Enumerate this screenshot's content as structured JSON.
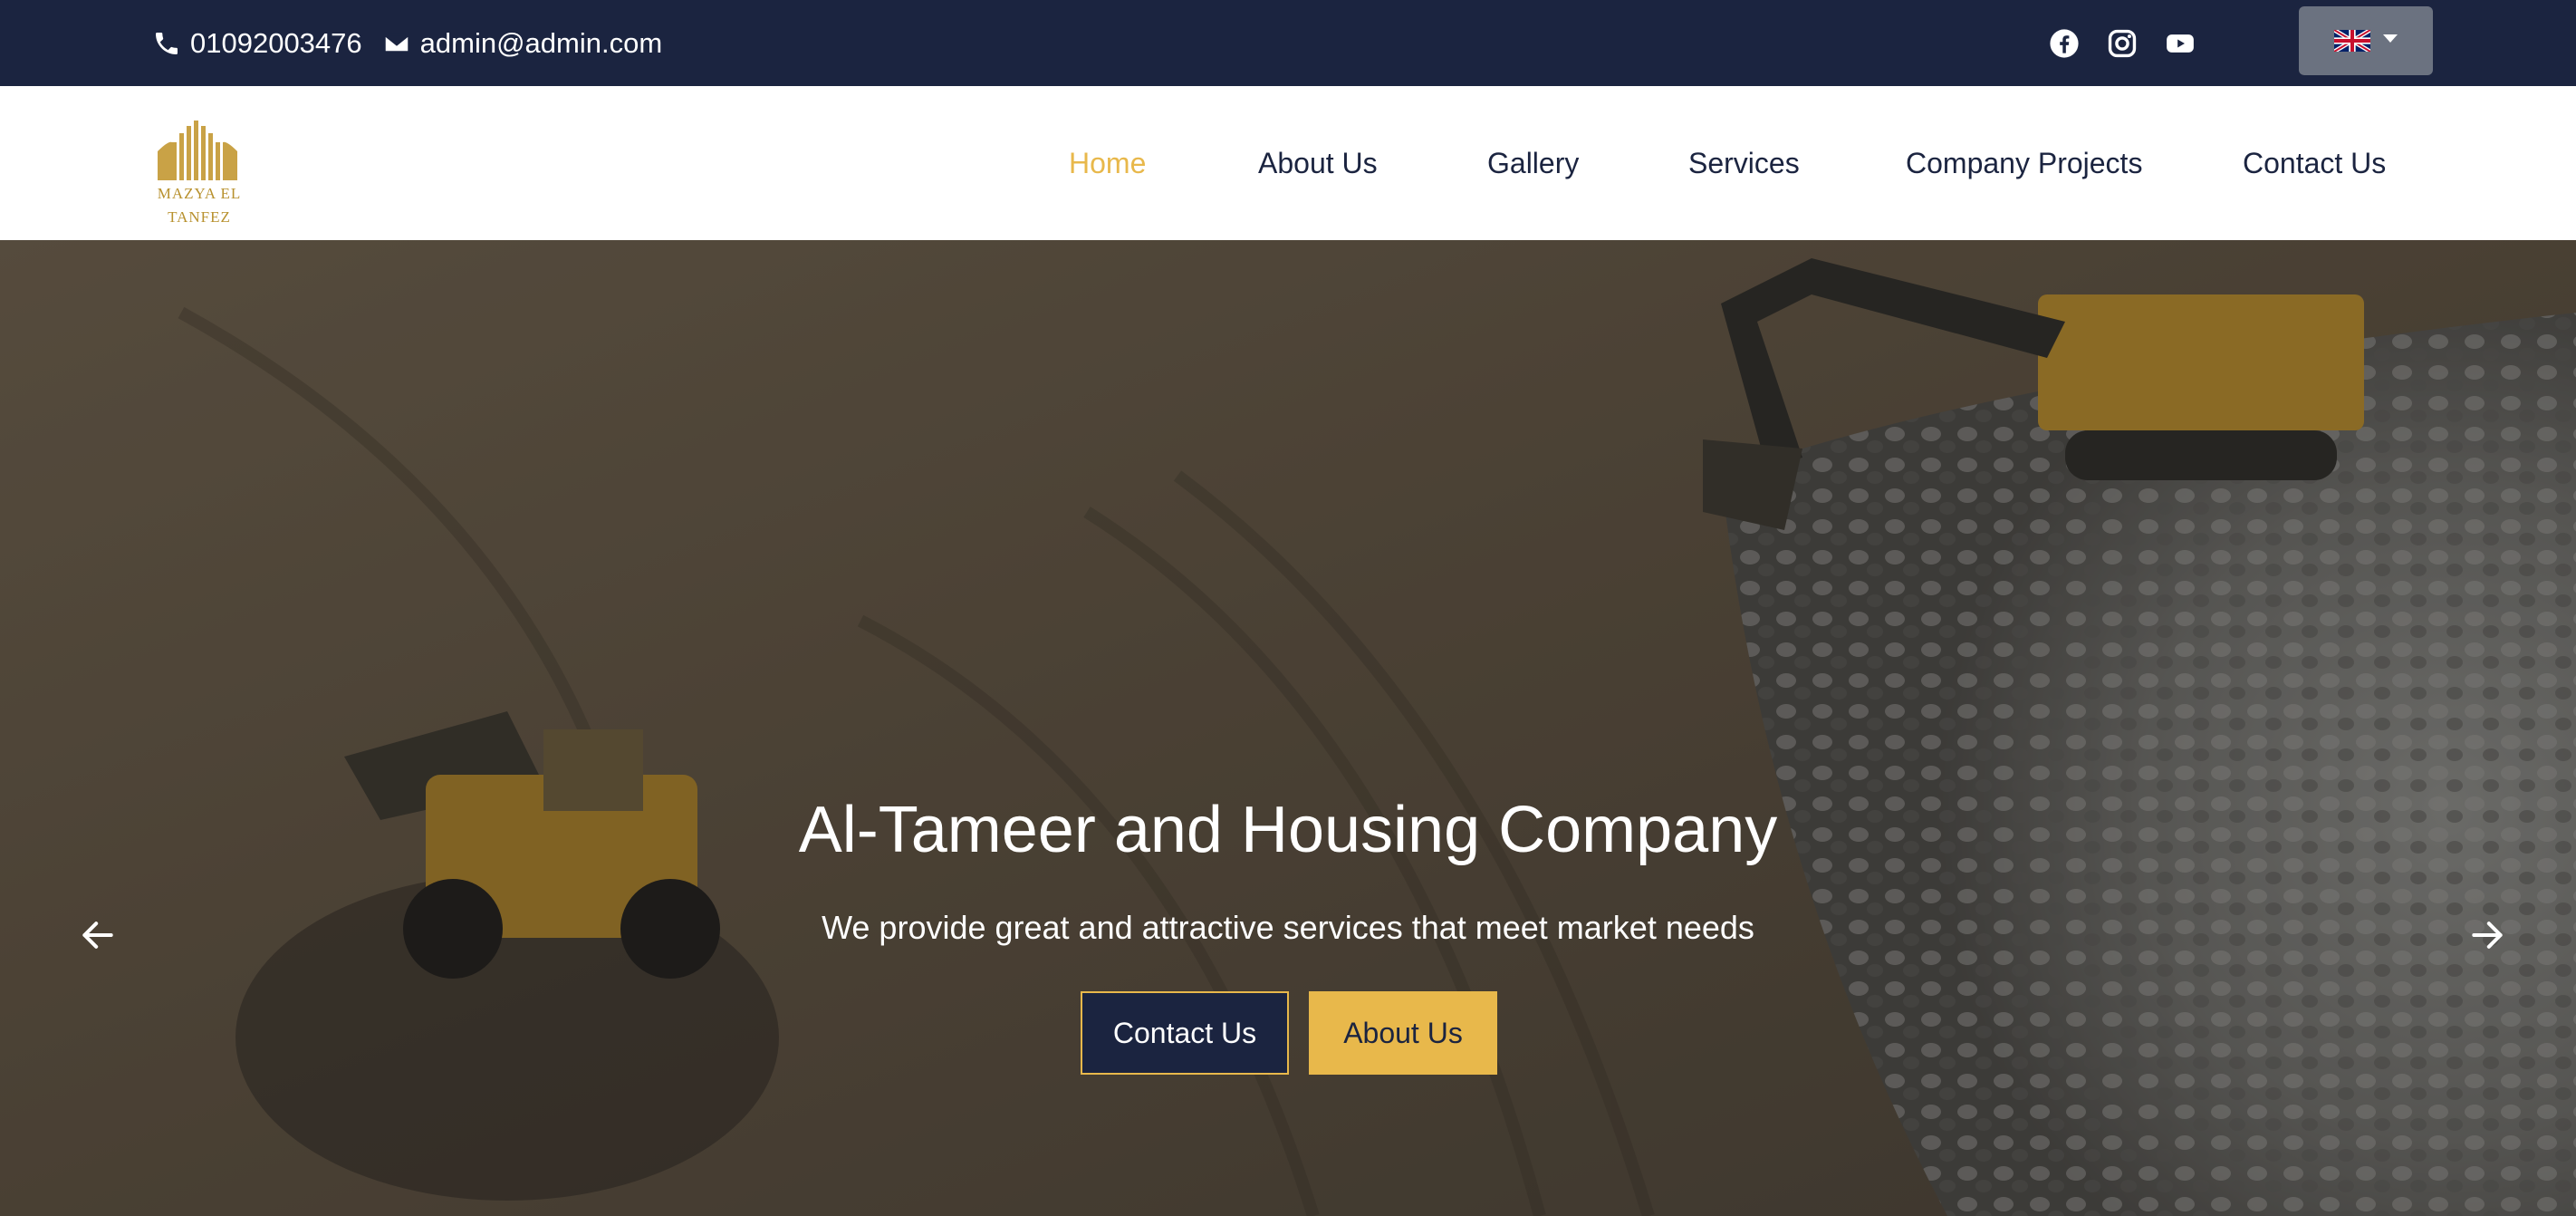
{
  "topbar": {
    "phone": "01092003476",
    "email": "admin@admin.com",
    "social": [
      "facebook-icon",
      "instagram-icon",
      "youtube-icon"
    ],
    "language_flag": "uk-flag-icon"
  },
  "logo": {
    "line1": "MAZYA EL",
    "line2": "TANFEZ"
  },
  "nav": {
    "items": [
      "Home",
      "About Us",
      "Gallery",
      "Services",
      "Company Projects",
      "Contact Us"
    ],
    "active": "Home"
  },
  "hero": {
    "title": "Al-Tameer and Housing Company",
    "subtitle": "We provide great and attractive services that meet market needs",
    "contact_button": "Contact Us",
    "about_button": "About Us"
  },
  "colors": {
    "navy": "#1b2440",
    "gold": "#e8b84b",
    "logo_gold": "#b8912e"
  }
}
